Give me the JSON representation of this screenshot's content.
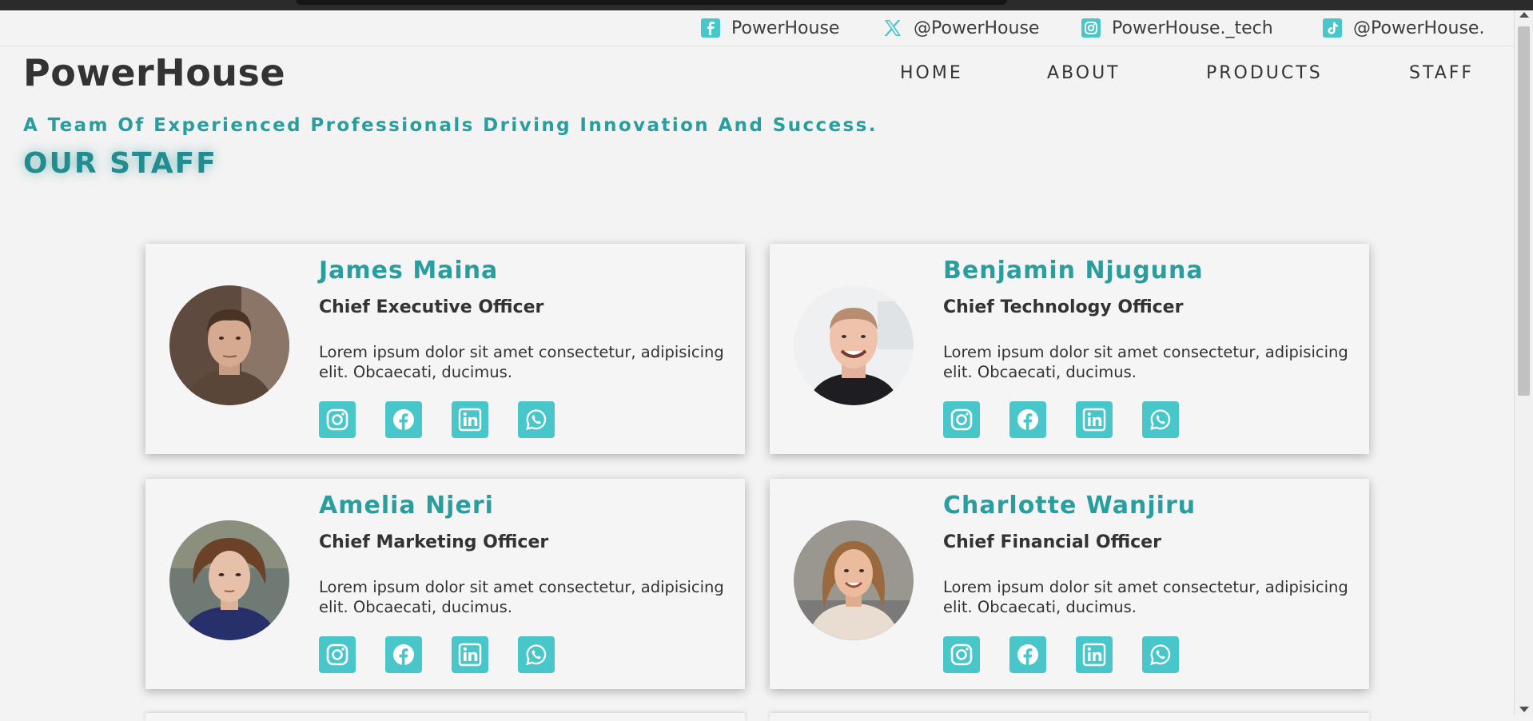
{
  "topbar": {
    "socials": [
      {
        "icon": "facebook-icon",
        "label": "PowerHouse"
      },
      {
        "icon": "x-twitter-icon",
        "label": "@PowerHouse"
      },
      {
        "icon": "instagram-icon",
        "label": "PowerHouse._tech"
      },
      {
        "icon": "tiktok-icon",
        "label": "@PowerHouse."
      }
    ]
  },
  "header": {
    "brand": "PowerHouse",
    "nav": [
      "HOME",
      "ABOUT",
      "PRODUCTS",
      "STAFF"
    ]
  },
  "hero": {
    "tagline": "A Team Of Experienced Professionals Driving Innovation And Success.",
    "section_title": "OUR STAFF"
  },
  "staff": [
    {
      "name": "James Maina",
      "role": "Chief Executive Officer",
      "bio": "Lorem ipsum dolor sit amet consectetur, adipisicing elit. Obcaecati, ducimus."
    },
    {
      "name": "Benjamin Njuguna",
      "role": "Chief Technology Officer",
      "bio": "Lorem ipsum dolor sit amet consectetur, adipisicing elit. Obcaecati, ducimus."
    },
    {
      "name": "Amelia Njeri",
      "role": "Chief Marketing Officer",
      "bio": "Lorem ipsum dolor sit amet consectetur, adipisicing elit. Obcaecati, ducimus."
    },
    {
      "name": "Charlotte Wanjiru",
      "role": "Chief Financial Officer",
      "bio": "Lorem ipsum dolor sit amet consectetur, adipisicing elit. Obcaecati, ducimus."
    }
  ],
  "card_social_icons": [
    "instagram-icon",
    "facebook-icon",
    "linkedin-icon",
    "whatsapp-icon"
  ],
  "colors": {
    "accent": "#48c6c9",
    "heading": "#2a9d9e",
    "background": "#f3f3f3",
    "text": "#333333"
  }
}
